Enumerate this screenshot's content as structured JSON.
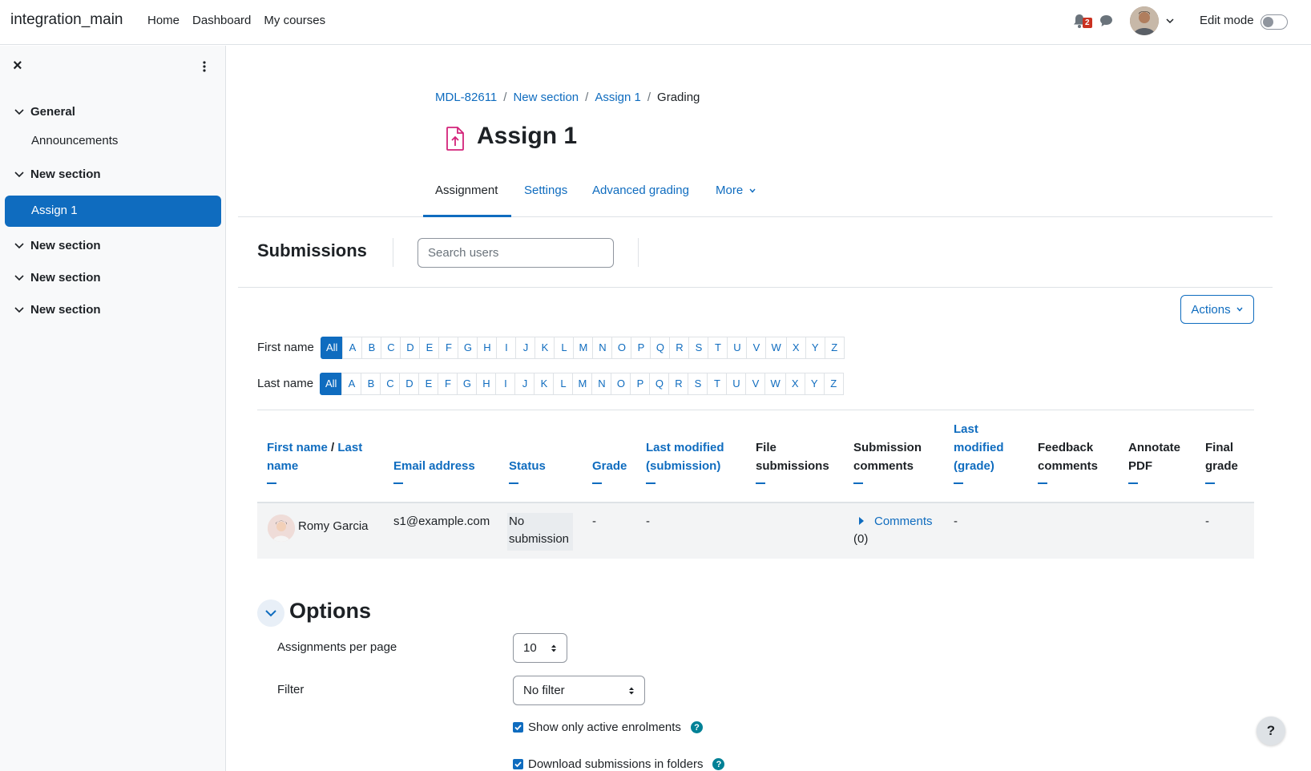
{
  "app": {
    "brand": "integration_main"
  },
  "primary_nav": [
    "Home",
    "Dashboard",
    "My courses"
  ],
  "notifications": {
    "count": "2"
  },
  "edit_mode": {
    "label": "Edit mode",
    "on": false
  },
  "sidebar": {
    "sections": [
      {
        "label": "General",
        "items": [
          "Announcements"
        ]
      },
      {
        "label": "New section",
        "items": [
          "Assign 1"
        ],
        "active_item": "Assign 1"
      },
      {
        "label": "New section",
        "items": []
      },
      {
        "label": "New section",
        "items": []
      },
      {
        "label": "New section",
        "items": []
      }
    ]
  },
  "breadcrumb": [
    "MDL-82611",
    "New section",
    "Assign 1",
    "Grading"
  ],
  "page": {
    "title": "Assign 1"
  },
  "tabs": [
    {
      "label": "Assignment",
      "active": true
    },
    {
      "label": "Settings"
    },
    {
      "label": "Advanced grading"
    },
    {
      "label": "More"
    }
  ],
  "submissions": {
    "title": "Submissions",
    "search_placeholder": "Search users",
    "actions_label": "Actions"
  },
  "initials": {
    "first_label": "First name",
    "last_label": "Last name",
    "letters": [
      "All",
      "A",
      "B",
      "C",
      "D",
      "E",
      "F",
      "G",
      "H",
      "I",
      "J",
      "K",
      "L",
      "M",
      "N",
      "O",
      "P",
      "Q",
      "R",
      "S",
      "T",
      "U",
      "V",
      "W",
      "X",
      "Y",
      "Z"
    ],
    "selected": "All"
  },
  "table": {
    "headers": {
      "first_name": "First name",
      "slash": " / ",
      "last_name": "Last",
      "last_name_2": "name",
      "email": "Email address",
      "status": "Status",
      "grade": "Grade",
      "last_modified_sub_1": "Last modified",
      "last_modified_sub_2": "(submission)",
      "file_sub_1": "File",
      "file_sub_2": "submissions",
      "sub_comments_1": "Submission",
      "sub_comments_2": "comments",
      "last_mod_grade_1": "Last",
      "last_mod_grade_2": "modified",
      "last_mod_grade_3": "(grade)",
      "feedback_1": "Feedback",
      "feedback_2": "comments",
      "annotate_1": "Annotate",
      "annotate_2": "PDF",
      "final_1": "Final",
      "final_2": "grade"
    },
    "rows": [
      {
        "name": "Romy Garcia",
        "email": "s1@example.com",
        "status_1": "No",
        "status_2": "submission",
        "grade": "-",
        "last_modified": "-",
        "comments_1": "Comments",
        "comments_2": "(0)",
        "last_mod_grade": "-",
        "final_grade": "-"
      }
    ]
  },
  "options": {
    "title": "Options",
    "per_page_label": "Assignments per page",
    "per_page_value": "10",
    "filter_label": "Filter",
    "filter_value": "No filter",
    "active_enrolments_label": "Show only active enrolments",
    "download_folders_label": "Download submissions in folders"
  },
  "help_label": "?"
}
